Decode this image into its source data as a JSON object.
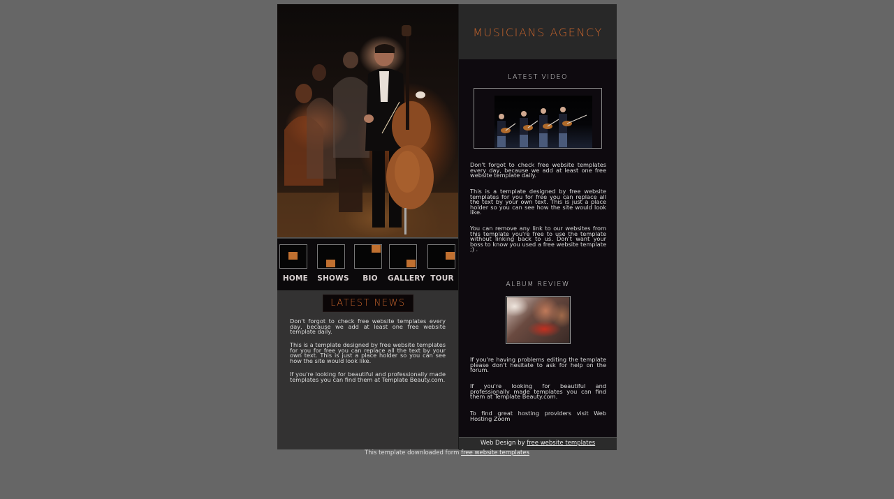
{
  "brand": {
    "title": "MUSICIANS AGENCY"
  },
  "nav": {
    "items": [
      {
        "label": "HOME"
      },
      {
        "label": "SHOWS"
      },
      {
        "label": "BIO"
      },
      {
        "label": "GALLERY"
      },
      {
        "label": "TOUR"
      }
    ]
  },
  "news": {
    "heading": "LATEST NEWS",
    "paragraphs": [
      "Don't forgot to check free website templates every day, because we add at least one free website template daily.",
      "This is a template designed by free website templates for you for free you can replace all the text by your own text. This is just a place holder so you can see how the site would look like.",
      "If you're looking for beautiful and professionally made templates you can find them at Template Beauty.com."
    ]
  },
  "video": {
    "heading": "LATEST VIDEO",
    "paragraphs": [
      "Don't forgot to check free website templates every day, because we add at least one free website template daily.",
      "This is a template designed by free website templates for you for free you can replace all the text by your own text. This is just a place holder so you can see how the site would look like.",
      "You can remove any link to our websites from this template you're free to use the template without linking back to us. Don't want your boss to know you used a free website template ;) ."
    ]
  },
  "album": {
    "heading": "ALBUM REVIEW",
    "paragraphs": [
      "If you're having problems editing the template please don't hesitate to ask for help on the forum.",
      "If you're looking for beautiful and professionally made templates you can find them at Template Beauty.com.",
      "To find great hosting providers visit Web Hosting Zoom"
    ]
  },
  "footer": {
    "prefix": "Web Design by",
    "link": "free website templates"
  },
  "download": {
    "prefix": "This template downloaded form",
    "link": "free website templates"
  },
  "colors": {
    "accent": "#c8642c",
    "page_bg": "#666666",
    "dark_panel": "#0e0a0f",
    "left_panel": "#333232"
  }
}
